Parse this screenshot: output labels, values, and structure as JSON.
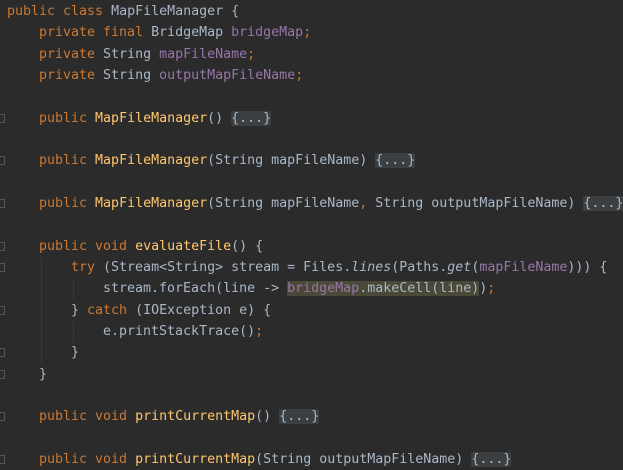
{
  "editor": {
    "colors": {
      "background": "#2b2b2b",
      "keyword": "#cc7832",
      "method": "#ffc66d",
      "field": "#9876aa",
      "text": "#a9b7c6",
      "highlight": "#4a4836"
    },
    "lines": [
      {
        "indent": 0,
        "tokens": [
          [
            "public class ",
            "kw"
          ],
          [
            "MapFileManager {",
            ""
          ]
        ]
      },
      {
        "indent": 1,
        "tokens": [
          [
            "private final ",
            "kw"
          ],
          [
            "BridgeMap ",
            ""
          ],
          [
            "bridgeMap",
            "fld"
          ],
          [
            ";",
            "kw"
          ]
        ]
      },
      {
        "indent": 1,
        "tokens": [
          [
            "private ",
            "kw"
          ],
          [
            "String ",
            ""
          ],
          [
            "mapFileName",
            "fld"
          ],
          [
            ";",
            "kw"
          ]
        ]
      },
      {
        "indent": 1,
        "tokens": [
          [
            "private ",
            "kw"
          ],
          [
            "String ",
            ""
          ],
          [
            "outputMapFileName",
            "fld"
          ],
          [
            ";",
            "kw"
          ]
        ]
      },
      {
        "indent": 0,
        "tokens": []
      },
      {
        "indent": 1,
        "fold": true,
        "tokens": [
          [
            "public ",
            "kw"
          ],
          [
            "MapFileManager",
            "fn"
          ],
          [
            "() ",
            ""
          ],
          [
            "{...}",
            "folded"
          ]
        ]
      },
      {
        "indent": 0,
        "tokens": []
      },
      {
        "indent": 1,
        "fold": true,
        "tokens": [
          [
            "public ",
            "kw"
          ],
          [
            "MapFileManager",
            "fn"
          ],
          [
            "(String mapFileName) ",
            ""
          ],
          [
            "{...}",
            "folded"
          ]
        ]
      },
      {
        "indent": 0,
        "tokens": []
      },
      {
        "indent": 1,
        "fold": true,
        "tokens": [
          [
            "public ",
            "kw"
          ],
          [
            "MapFileManager",
            "fn"
          ],
          [
            "(String mapFileName",
            ""
          ],
          [
            ", ",
            "kw"
          ],
          [
            "String outputMapFileName) ",
            ""
          ],
          [
            "{...}",
            "folded"
          ]
        ]
      },
      {
        "indent": 0,
        "tokens": []
      },
      {
        "indent": 1,
        "fold": true,
        "tokens": [
          [
            "public void ",
            "kw"
          ],
          [
            "evaluateFile",
            "fn"
          ],
          [
            "() {",
            ""
          ]
        ]
      },
      {
        "indent": 2,
        "fold": true,
        "tokens": [
          [
            "try ",
            "kw"
          ],
          [
            "(Stream<String> stream = Files.",
            ""
          ],
          [
            "lines",
            "it"
          ],
          [
            "(Paths.",
            ""
          ],
          [
            "get",
            "it"
          ],
          [
            "(",
            ""
          ],
          [
            "mapFileName",
            "fld"
          ],
          [
            "))) {",
            ""
          ]
        ]
      },
      {
        "indent": 3,
        "tokens": [
          [
            "stream.forEach(line -> ",
            ""
          ],
          [
            "bridgeMap",
            "fld hl"
          ],
          [
            ".makeCell(line)",
            "hl"
          ],
          [
            ")",
            ""
          ],
          [
            ";",
            "kw"
          ]
        ]
      },
      {
        "indent": 2,
        "fold": true,
        "tokens": [
          [
            "} ",
            ""
          ],
          [
            "catch ",
            "kw"
          ],
          [
            "(IOException e) {",
            ""
          ]
        ]
      },
      {
        "indent": 3,
        "tokens": [
          [
            "e.printStackTrace()",
            ""
          ],
          [
            ";",
            "kw"
          ]
        ]
      },
      {
        "indent": 2,
        "fold": true,
        "tokens": [
          [
            "}",
            ""
          ]
        ]
      },
      {
        "indent": 1,
        "fold": true,
        "tokens": [
          [
            "}",
            ""
          ]
        ]
      },
      {
        "indent": 0,
        "tokens": []
      },
      {
        "indent": 1,
        "fold": true,
        "tokens": [
          [
            "public void ",
            "kw"
          ],
          [
            "printCurrentMap",
            "fn"
          ],
          [
            "() ",
            ""
          ],
          [
            "{...}",
            "folded"
          ]
        ]
      },
      {
        "indent": 0,
        "tokens": []
      },
      {
        "indent": 1,
        "fold": true,
        "tokens": [
          [
            "public void ",
            "kw"
          ],
          [
            "printCurrentMap",
            "fn"
          ],
          [
            "(String outputMapFileName) ",
            ""
          ],
          [
            "{...}",
            "folded"
          ]
        ]
      }
    ]
  }
}
